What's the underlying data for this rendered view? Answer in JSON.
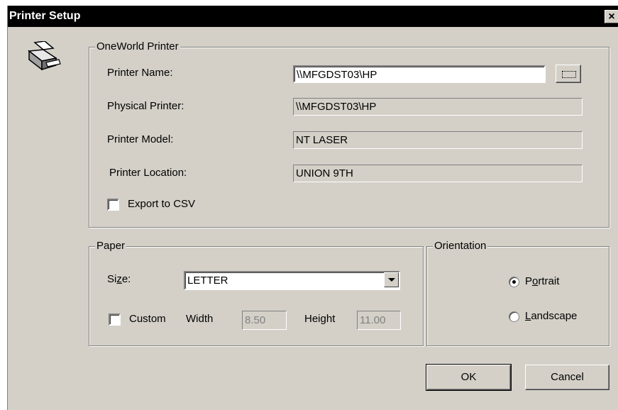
{
  "window": {
    "title": "Printer Setup",
    "close_glyph": "×"
  },
  "oneworld_printer": {
    "group_label": "OneWorld Printer",
    "printer_name": {
      "label": "Printer Name:",
      "value": "\\\\MFGDST03\\HP",
      "browse_icon": "ellipsis-icon"
    },
    "physical_printer": {
      "label": "Physical Printer:",
      "value": "\\\\MFGDST03\\HP"
    },
    "printer_model": {
      "label": "Printer Model:",
      "value": "NT LASER"
    },
    "printer_location": {
      "label": "Printer Location:",
      "value": "UNION 9TH"
    },
    "export_csv": {
      "label": "Export to CSV",
      "checked": false
    }
  },
  "paper": {
    "group_label": "Paper",
    "size_label_pre": "Si",
    "size_label_u": "z",
    "size_label_post": "e:",
    "size_value": "LETTER",
    "custom": {
      "label": "Custom",
      "checked": false
    },
    "width": {
      "label": "Width",
      "value": "8.50"
    },
    "height": {
      "label": "Height",
      "value": "11.00"
    }
  },
  "orientation": {
    "group_label": "Orientation",
    "portrait": {
      "label_pre": "P",
      "label_u": "o",
      "label_post": "rtrait",
      "selected": true
    },
    "landscape": {
      "label_pre": "",
      "label_u": "L",
      "label_post": "andscape",
      "selected": false
    }
  },
  "buttons": {
    "ok": "OK",
    "cancel": "Cancel"
  }
}
